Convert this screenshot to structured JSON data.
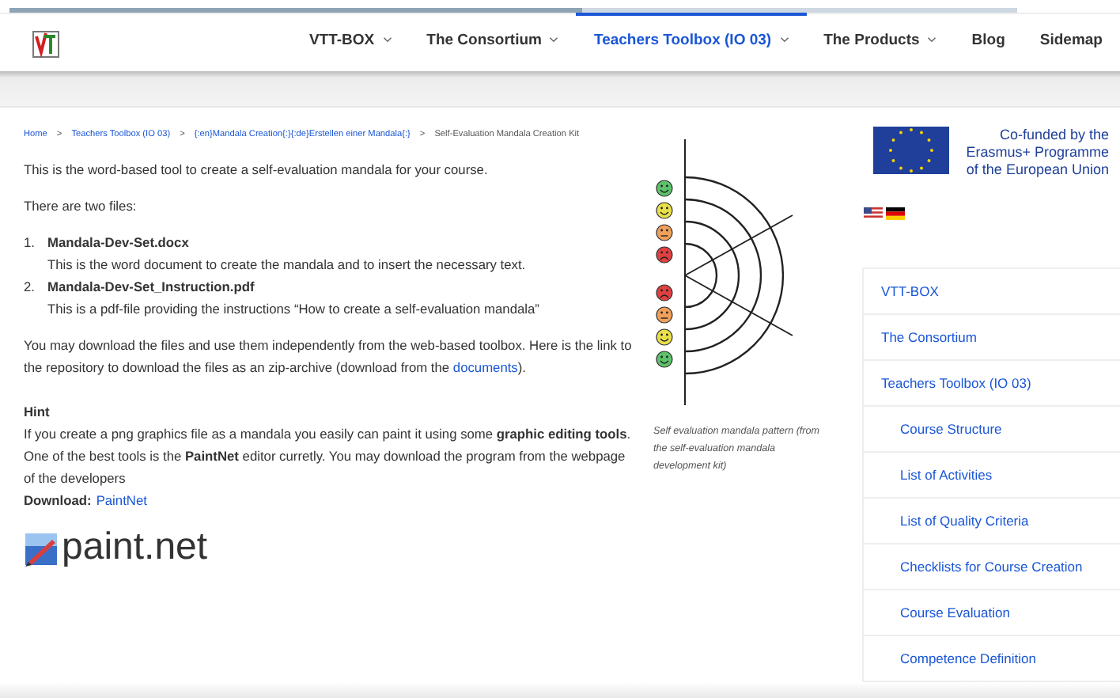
{
  "nav": {
    "items": [
      {
        "label": "VTT-BOX",
        "dropdown": true,
        "selected": false
      },
      {
        "label": "The Consortium",
        "dropdown": true,
        "selected": false
      },
      {
        "label": "Teachers Toolbox (IO 03)",
        "dropdown": true,
        "selected": true
      },
      {
        "label": "The Products",
        "dropdown": true,
        "selected": false
      },
      {
        "label": "Blog",
        "dropdown": false,
        "selected": false
      },
      {
        "label": "Sidemap",
        "dropdown": false,
        "selected": false
      }
    ]
  },
  "breadcrumb": {
    "links": [
      "Home",
      "Teachers Toolbox (IO 03)",
      "{:en}Mandala Creation{:}{:de}Erstellen einer Mandala{:}"
    ],
    "current": "Self-Evaluation Mandala Creation Kit",
    "separator": ">"
  },
  "intro": "This is the word-based tool to create a self-evaluation mandala for your course.",
  "files_intro": "There are two files:",
  "files": [
    {
      "number": "1.",
      "name": "Mandala-Dev-Set.docx",
      "description": "This is the word document to create the mandala and to insert the necessary text."
    },
    {
      "number": "2.",
      "name": "Mandala-Dev-Set_Instruction.pdf",
      "description": "This is a pdf-file providing the instructions “How to create a self-evaluation mandala”"
    }
  ],
  "download_text": "You may download the files and use them independently from the web-based toolbox. Here is the link to the repository to download the files as an zip-archive (download from the",
  "download_link": "documents",
  "download_end": ").",
  "hint": {
    "title": "Hint",
    "text": "If you create a png graphics file as a mandala you easily can paint it using some **graphic editing tools**. One of the best tools is the **PaintNet** editor curretly. You may download the program from the webpage of the developers",
    "download_label": "Download:",
    "download_link": "PaintNet"
  },
  "logo_text": "paint.net",
  "figure": {
    "caption": "Self evaluation mandala pattern (from the self-evaluation mandala development kit)"
  },
  "funding": {
    "text": "Co-funded by the Erasmus+ Programme of the European Union"
  },
  "sidebar": {
    "items": [
      {
        "label": "VTT-BOX"
      },
      {
        "label": "The Consortium"
      },
      {
        "label": "Teachers Toolbox (IO 03)",
        "children": [
          {
            "label": "Course Structure"
          },
          {
            "label": "List of Activities"
          },
          {
            "label": "List of Quality Criteria"
          },
          {
            "label": "Checklists for Course Creation"
          },
          {
            "label": "Course Evaluation"
          },
          {
            "label": "Competence Definition"
          }
        ]
      }
    ]
  }
}
